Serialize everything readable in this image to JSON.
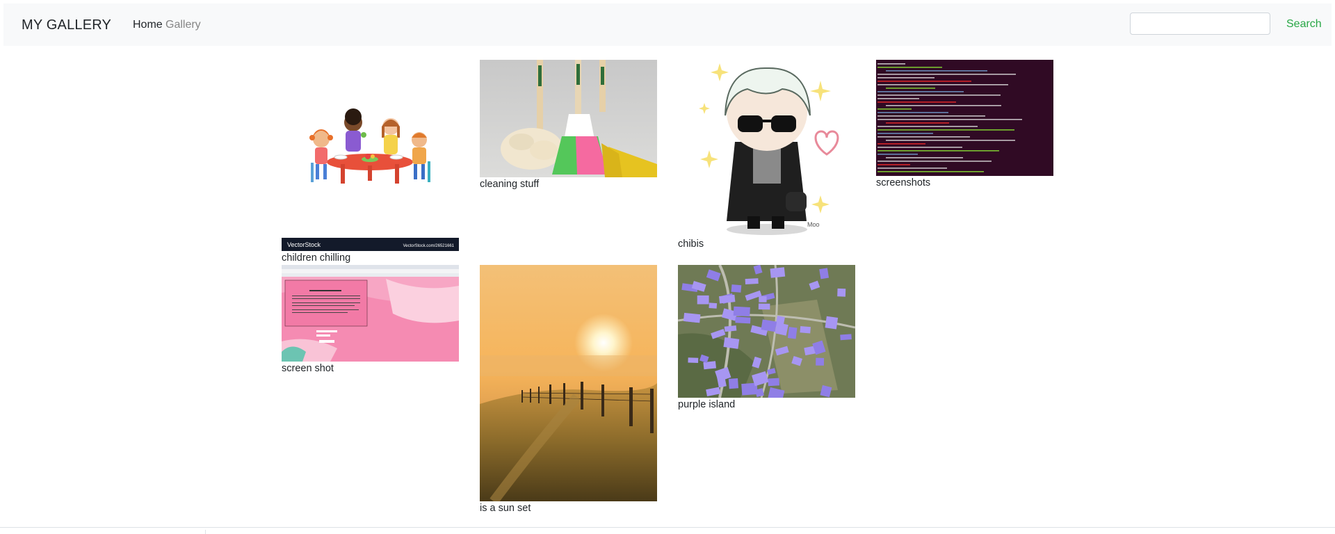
{
  "navbar": {
    "brand": "MY GALLERY",
    "links": {
      "home": "Home",
      "gallery": "Gallery"
    },
    "search": {
      "placeholder": "",
      "value": "",
      "button_label": "Search"
    }
  },
  "gallery": {
    "items": [
      {
        "caption": "children chilling",
        "image": "cartoon children eating at a table",
        "watermark_left": "VectorStock",
        "watermark_right": "VectorStock.com/26521661"
      },
      {
        "caption": "cleaning stuff",
        "image": "mop, broom and dustpan"
      },
      {
        "caption": "chibis",
        "image": "chibi character with sunglasses and black coat",
        "signature": "Moo"
      },
      {
        "caption": "screenshots",
        "image": "terminal screenshot with git commands"
      },
      {
        "caption": "screen shot",
        "image": "pink web page screenshot"
      },
      {
        "caption": "is a sun set",
        "image": "sunset over field with fence"
      },
      {
        "caption": "purple island",
        "image": "aerial view of purple-roofed houses"
      }
    ]
  },
  "colors": {
    "navbar_bg": "#f8f9fa",
    "search_button": "#28a745",
    "nav_inactive": "#858585",
    "terminal_bg": "#300a24"
  }
}
